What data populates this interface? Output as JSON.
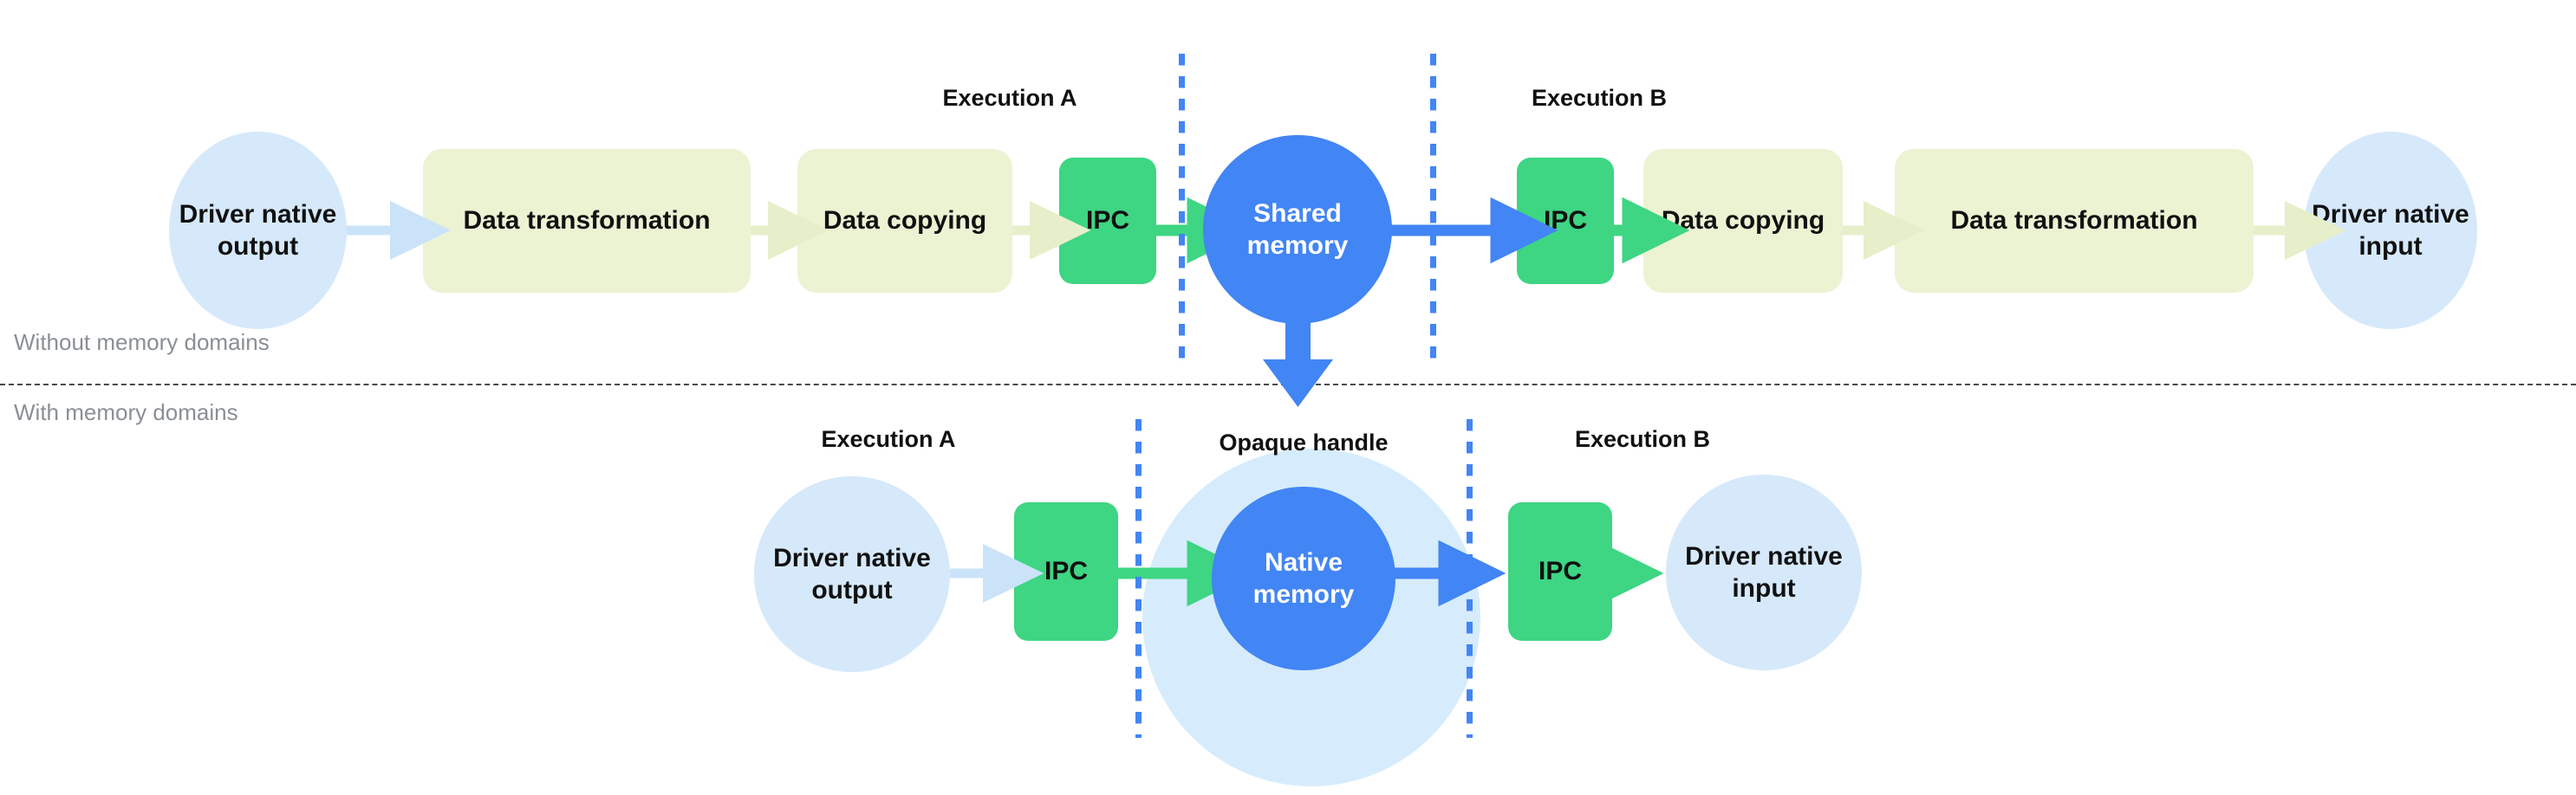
{
  "diagram": {
    "title": "Memory domains data flow comparison",
    "colors": {
      "light_blue": "#d6e9fb",
      "blue": "#4285f4",
      "green": "#3ed583",
      "yellow_green": "#ecf3d3",
      "halo_blue": "#d6ecfc",
      "caption_gray": "#8a8f94",
      "divider_gray": "#4a4a4a"
    }
  },
  "divider": {
    "above_label": "Without memory domains",
    "below_label": "With memory domains"
  },
  "top_row": {
    "execution_a_label": "Execution A",
    "execution_b_label": "Execution B",
    "nodes": {
      "driver_output": "Driver native output",
      "data_transformation_left": "Data transformation",
      "data_copying_left": "Data copying",
      "ipc_left": "IPC",
      "shared_memory": "Shared memory",
      "ipc_right": "IPC",
      "data_copying_right": "Data copying",
      "data_transformation_right": "Data transformation",
      "driver_input": "Driver native input"
    }
  },
  "bottom_row": {
    "execution_a_label": "Execution A",
    "execution_b_label": "Execution B",
    "opaque_handle_label": "Opaque handle",
    "nodes": {
      "driver_output": "Driver native output",
      "ipc_left": "IPC",
      "native_memory": "Native memory",
      "ipc_right": "IPC",
      "driver_input": "Driver native input"
    }
  }
}
